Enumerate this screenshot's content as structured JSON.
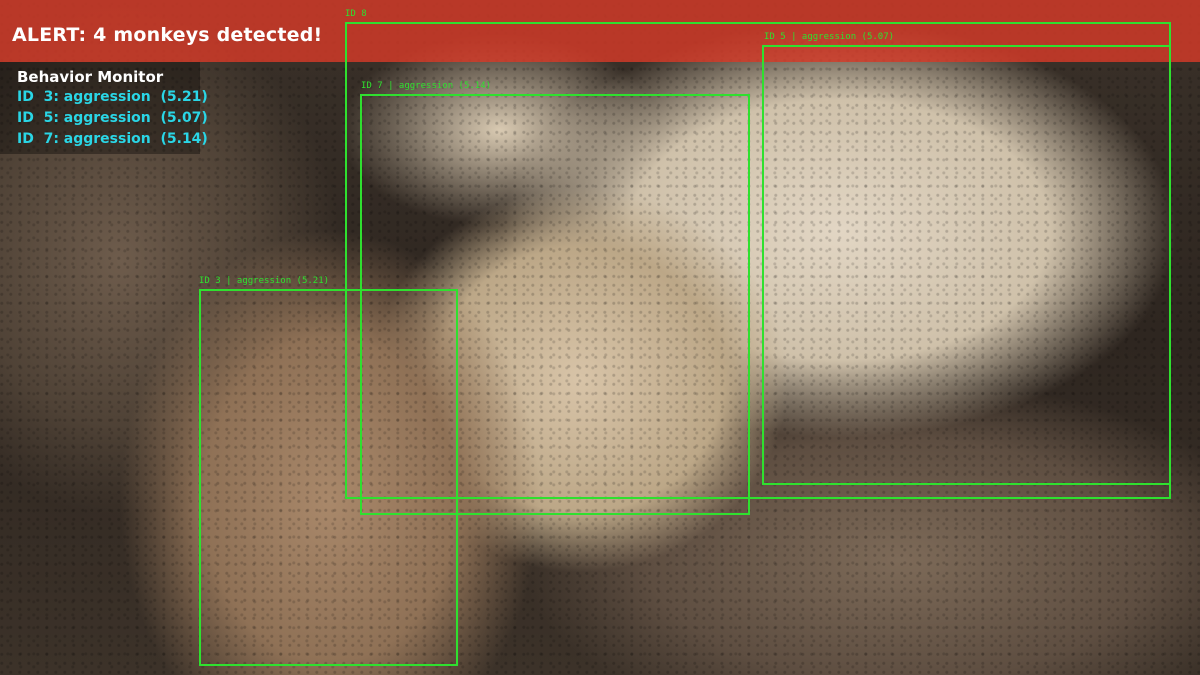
{
  "alert": {
    "text": "ALERT: 4 monkeys detected!",
    "color": "#d63a28"
  },
  "behavior_monitor": {
    "title": "Behavior Monitor",
    "lines": [
      "ID  3: aggression  (5.21)",
      "ID  5: aggression  (5.07)",
      "ID  7: aggression  (5.14)"
    ],
    "line_color": "#2ad6e6"
  },
  "detections": [
    {
      "label": "ID 8",
      "color": "#2fe02f"
    },
    {
      "label": "ID 5 | aggression (5.07)",
      "color": "#2fe02f"
    },
    {
      "label": "ID 7 | aggression (5.14)",
      "color": "#2fe02f"
    },
    {
      "label": "ID 3 | aggression (5.21)",
      "color": "#2fe02f"
    }
  ]
}
